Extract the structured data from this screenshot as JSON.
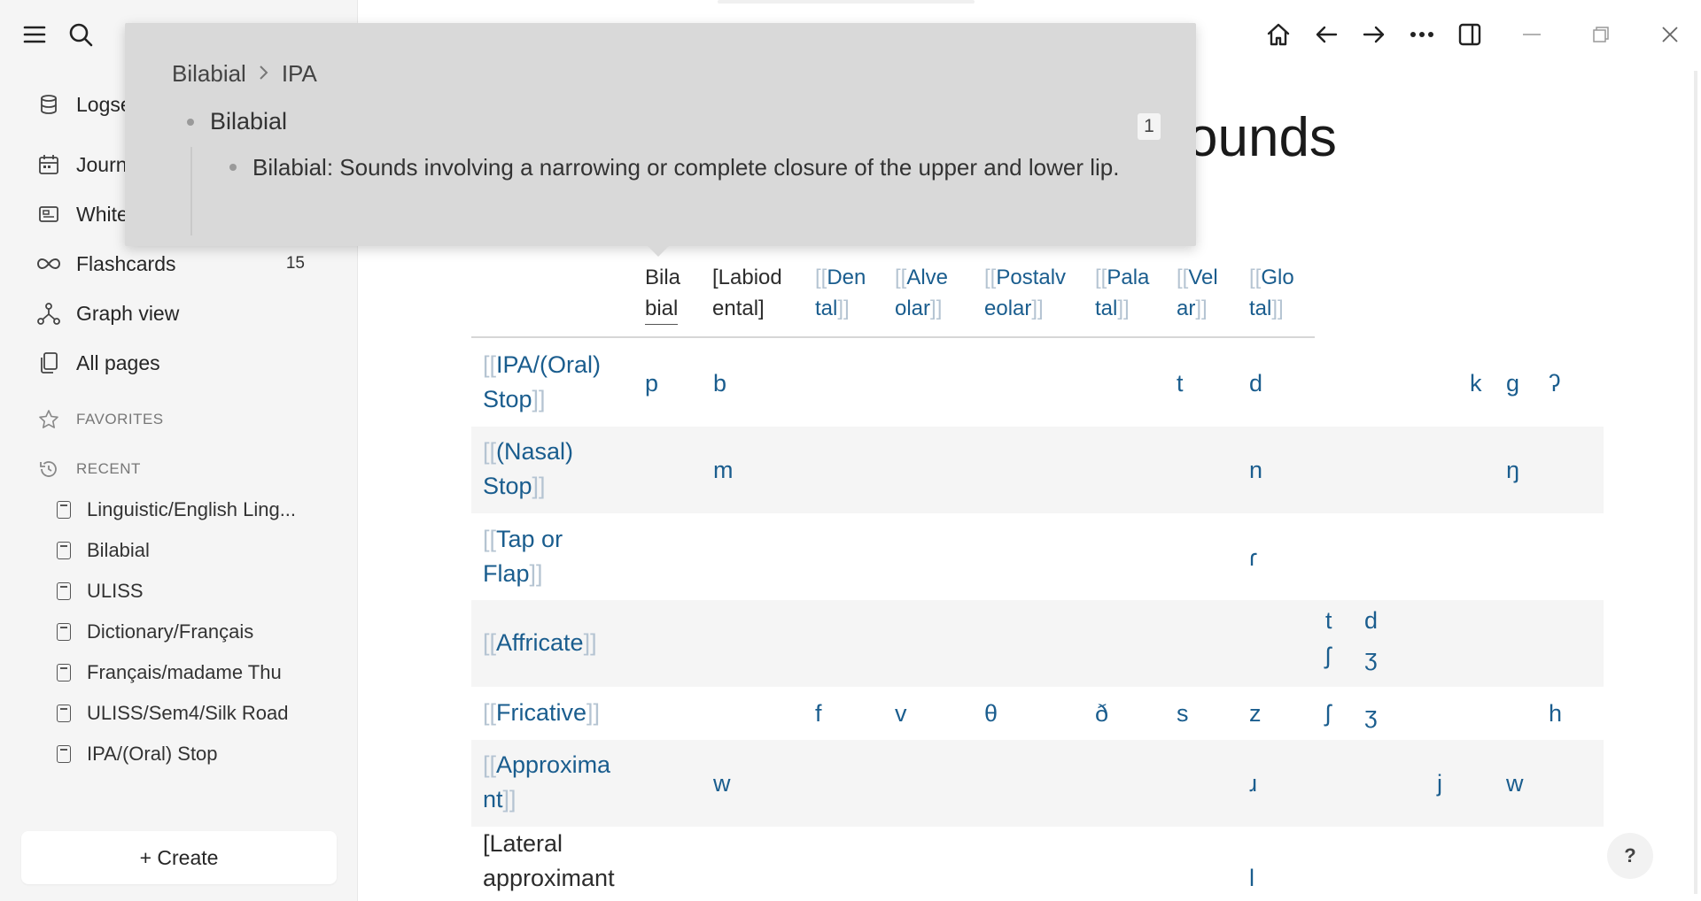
{
  "sidebar": {
    "nav": [
      {
        "label": "Logseq",
        "icon": "database-icon"
      },
      {
        "label": "Journals",
        "icon": "calendar-icon"
      },
      {
        "label": "Whiteboards",
        "icon": "whiteboard-icon"
      },
      {
        "label": "Flashcards",
        "icon": "infinity-icon",
        "count": "15"
      },
      {
        "label": "Graph view",
        "icon": "graph-icon"
      },
      {
        "label": "All pages",
        "icon": "pages-icon"
      }
    ],
    "favorites_label": "FAVORITES",
    "recent_label": "RECENT",
    "recent": [
      "Linguistic/English Ling...",
      "Bilabial",
      "ULISS",
      "Dictionary/Français",
      "Français/madame Thu",
      "ULISS/Sem4/Silk Road",
      "IPA/(Oral) Stop"
    ],
    "create_label": "+ Create"
  },
  "page": {
    "title_visible": "ounds"
  },
  "popover": {
    "breadcrumb": [
      "Bilabial",
      "IPA"
    ],
    "block_title": "Bilabial",
    "ref_count": "1",
    "child_text": "Bilabial: Sounds involving a narrowing or complete closure of the upper and lower lip."
  },
  "table": {
    "headers": [
      {
        "text": "Bilabial",
        "lines": [
          "Bila",
          "bial"
        ]
      },
      {
        "text": "[Labiodental]",
        "lines": [
          "[Labiod",
          "ental]"
        ]
      },
      {
        "text": "Dental",
        "lines": [
          "Den",
          "tal"
        ]
      },
      {
        "text": "Alveolar",
        "lines": [
          "Alve",
          "olar"
        ]
      },
      {
        "text": "Postalveolar",
        "lines": [
          "Postalv",
          "eolar"
        ]
      },
      {
        "text": "Palatal",
        "lines": [
          "Pala",
          "tal"
        ]
      },
      {
        "text": "Velar",
        "lines": [
          "Vel",
          "ar"
        ]
      },
      {
        "text": "Glottal",
        "lines": [
          "Glo",
          "tal"
        ]
      }
    ],
    "rows": [
      {
        "label_lines": [
          "IPA/(Oral)",
          "Stop"
        ],
        "cells": [
          "p",
          "b",
          "t",
          "d",
          "k",
          "g",
          "ʔ"
        ]
      },
      {
        "label_lines": [
          "(Nasal)",
          "Stop"
        ],
        "cells": [
          "m",
          "n",
          "ŋ"
        ]
      },
      {
        "label_lines": [
          "Tap or",
          "Flap"
        ],
        "cells": [
          "ɾ"
        ]
      },
      {
        "label_lines": [
          "Affricate"
        ],
        "cells": [
          "t",
          "ʃ",
          "d",
          "ʒ"
        ]
      },
      {
        "label_lines": [
          "Fricative"
        ],
        "cells": [
          "f",
          "v",
          "θ",
          "ð",
          "s",
          "z",
          "ʃ",
          "ʒ",
          "h"
        ]
      },
      {
        "label_lines": [
          "Approxima",
          "nt"
        ],
        "cells": [
          "w",
          "ɹ",
          "j",
          "w"
        ]
      },
      {
        "label_lines": [
          "[Lateral",
          "approximant"
        ],
        "cells": [
          "l"
        ]
      }
    ]
  },
  "help_label": "?"
}
